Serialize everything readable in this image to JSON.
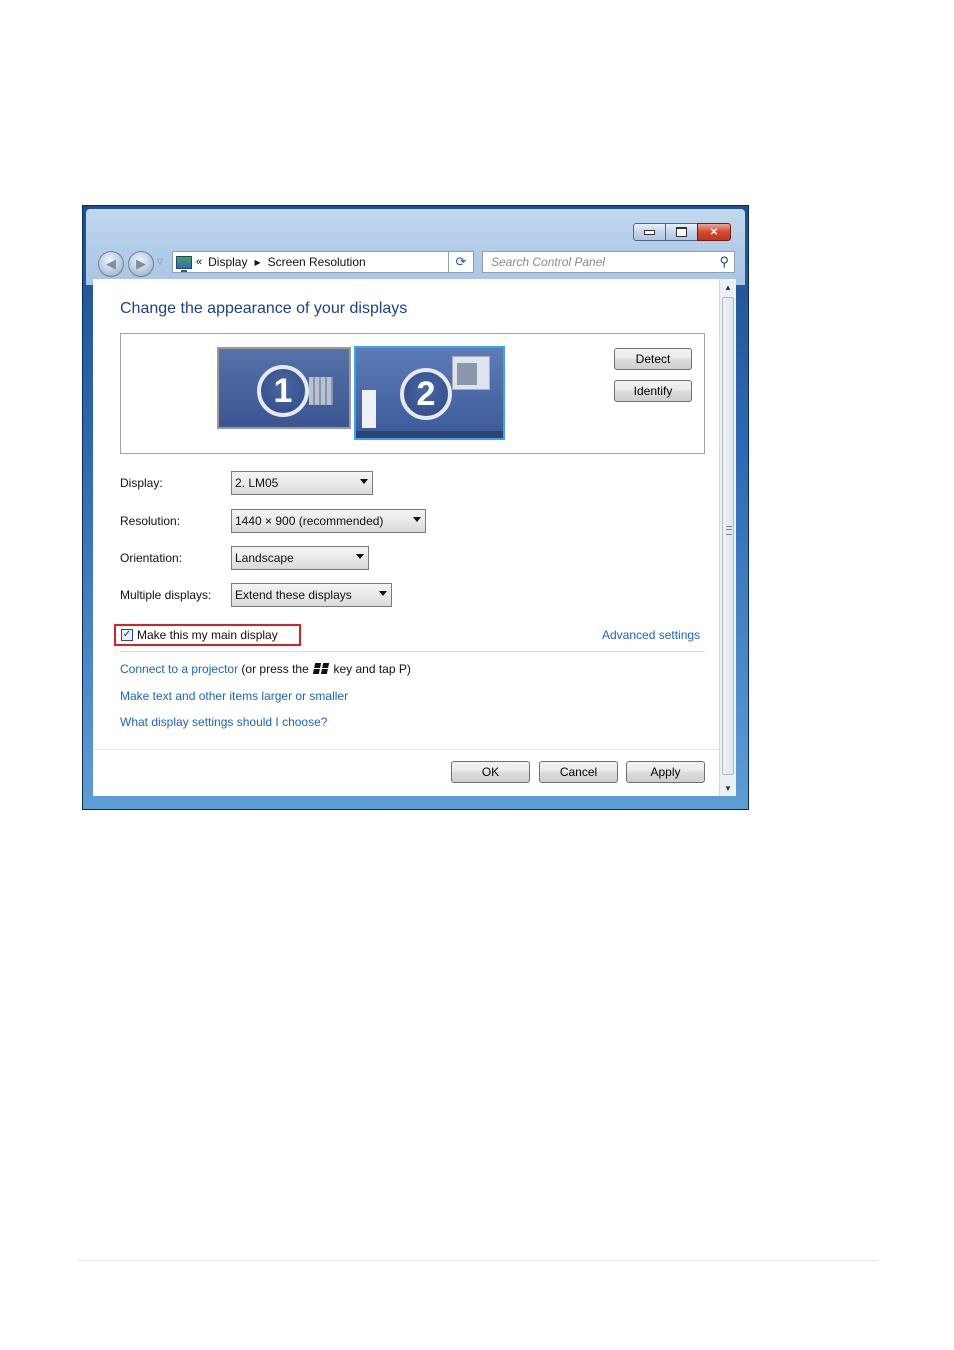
{
  "window": {
    "breadcrumb": {
      "chevron": "«",
      "items": [
        "Display",
        "Screen Resolution"
      ]
    },
    "search_placeholder": "Search Control Panel",
    "caption_buttons": [
      "minimize-icon",
      "maximize-icon",
      "close-icon"
    ]
  },
  "main": {
    "heading": "Change the appearance of your displays",
    "monitors": [
      {
        "number": "1"
      },
      {
        "number": "2",
        "selected": true
      }
    ],
    "detect_label": "Detect",
    "identify_label": "Identify",
    "fields": {
      "display": {
        "label": "Display:",
        "value": "2. LM05"
      },
      "resolution": {
        "label": "Resolution:",
        "value": "1440 × 900 (recommended)"
      },
      "orientation": {
        "label": "Orientation:",
        "value": "Landscape"
      },
      "multiple": {
        "label": "Multiple displays:",
        "value": "Extend these displays"
      }
    },
    "main_display": {
      "label": "Make this my main display",
      "checked": true
    },
    "advanced_link": "Advanced settings",
    "projector": {
      "link": "Connect to a projector",
      "pre": "(or press the",
      "post": "key and tap P)"
    },
    "text_size_link": "Make text and other items larger or smaller",
    "help_link": "What display settings should I choose?",
    "buttons": {
      "ok": "OK",
      "cancel": "Cancel",
      "apply": "Apply"
    }
  },
  "colors": {
    "highlight_box": "#d91f2a",
    "link": "#1a63c7",
    "heading": "#1e3f8c",
    "selected_monitor_border": "#3ea2ee"
  }
}
